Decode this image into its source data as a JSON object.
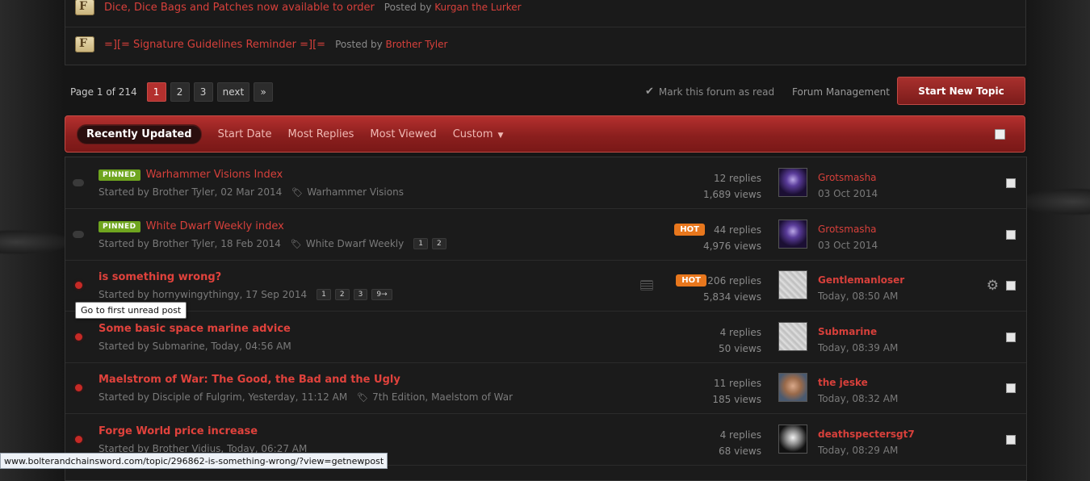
{
  "announcements": [
    {
      "title": "Dice, Dice Bags and Patches now available to order",
      "posted_by_label": "Posted by",
      "author": "Kurgan the Lurker"
    },
    {
      "title": "=][= Signature Guidelines Reminder =][=",
      "posted_by_label": "Posted by",
      "author": "Brother Tyler"
    }
  ],
  "pagination": {
    "label": "Page 1 of 214",
    "pages": [
      "1",
      "2",
      "3"
    ],
    "next": "next",
    "last": "»"
  },
  "actions": {
    "mark_read": "Mark this forum as read",
    "forum_management": "Forum Management",
    "start_new_topic": "Start New Topic"
  },
  "sort_tabs": {
    "recently_updated": "Recently Updated",
    "start_date": "Start Date",
    "most_replies": "Most Replies",
    "most_viewed": "Most Viewed",
    "custom": "Custom"
  },
  "topics": [
    {
      "pinned": "PINNED",
      "title": "Warhammer Visions Index",
      "started": "Started by Brother Tyler, 02 Mar 2014",
      "tag": "Warhammer Visions",
      "replies": "12 replies",
      "views": "1,689 views",
      "last_user": "Grotsmasha",
      "last_time": "03 Oct 2014"
    },
    {
      "pinned": "PINNED",
      "title": "White Dwarf Weekly index",
      "started": "Started by Brother Tyler, 18 Feb 2014",
      "tag": "White Dwarf Weekly",
      "mini_pages": [
        "1",
        "2"
      ],
      "hot": "HOT",
      "replies": "44 replies",
      "views": "4,976 views",
      "last_user": "Grotsmasha",
      "last_time": "03 Oct 2014"
    },
    {
      "title": "is something wrong?",
      "started": "Started by hornywingythingy, 17 Sep 2014",
      "mini_pages": [
        "1",
        "2",
        "3",
        "9→"
      ],
      "hot": "HOT",
      "replies": "206 replies",
      "views": "5,834 views",
      "last_user": "Gentlemanloser",
      "last_time": "Today, 08:50 AM"
    },
    {
      "title": "Some basic space marine advice",
      "started": "Started by Submarine, Today, 04:56 AM",
      "replies": "4 replies",
      "views": "50 views",
      "last_user": "Submarine",
      "last_time": "Today, 08:39 AM"
    },
    {
      "title": "Maelstrom of War: The Good, the Bad and the Ugly",
      "started": "Started by Disciple of Fulgrim, Yesterday, 11:12 AM",
      "tag": "7th Edition, Maelstom of War",
      "replies": "11 replies",
      "views": "185 views",
      "last_user": "the jeske",
      "last_time": "Today, 08:32 AM"
    },
    {
      "title": "Forge World price increase",
      "started": "Started by Brother Vidius, Today, 06:27 AM",
      "replies": "4 replies",
      "views": "68 views",
      "last_user": "deathspectersgt7",
      "last_time": "Today, 08:29 AM"
    }
  ],
  "tooltip": "Go to first unread post",
  "status_url": "www.bolterandchainsword.com/topic/296862-is-something-wrong/?view=getnewpost",
  "icons": {
    "announcement": "scroll-icon",
    "check": "checkmark-icon",
    "tag": "tag-icon",
    "gear": "gear-icon"
  },
  "colors": {
    "link_red": "#d7403b",
    "pinned_green": "#6fa51f",
    "hot_orange": "#e8771d",
    "button_red": "#a8302d"
  }
}
